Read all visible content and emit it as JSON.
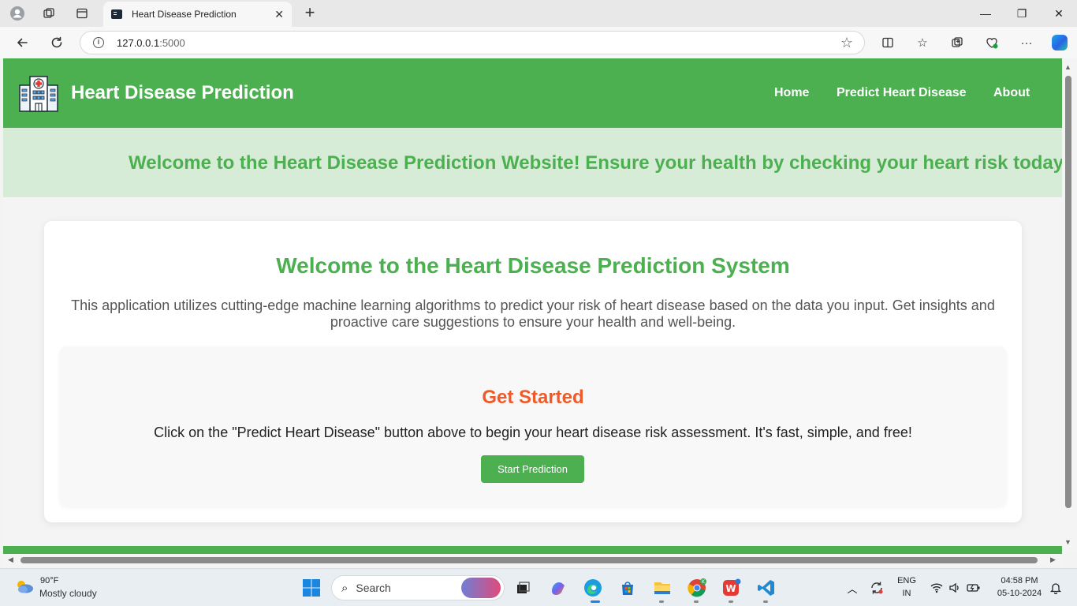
{
  "browser": {
    "tab_title": "Heart Disease Prediction",
    "url_host": "127.0.0.1",
    "url_port": ":5000"
  },
  "site": {
    "title": "Heart Disease Prediction",
    "nav": [
      "Home",
      "Predict Heart Disease",
      "About"
    ],
    "marquee": "Welcome to the Heart Disease Prediction Website! Ensure your health by checking your heart risk today"
  },
  "card": {
    "title": "Welcome to the Heart Disease Prediction System",
    "description": "This application utilizes cutting-edge machine learning algorithms to predict your risk of heart disease based on the data you input. Get insights and proactive care suggestions to ensure your health and well-being.",
    "get_started_title": "Get Started",
    "get_started_text": "Click on the \"Predict Heart Disease\" button above to begin your heart disease risk assessment. It's fast, simple, and free!",
    "button_label": "Start Prediction"
  },
  "taskbar": {
    "weather_temp": "90°F",
    "weather_desc": "Mostly cloudy",
    "search_label": "Search",
    "lang_line1": "ENG",
    "lang_line2": "IN",
    "time": "04:58 PM",
    "date": "05-10-2024"
  },
  "colors": {
    "brand_green": "#4caf50",
    "accent_orange": "#f05a28",
    "marquee_bg": "#d6ecd6"
  }
}
